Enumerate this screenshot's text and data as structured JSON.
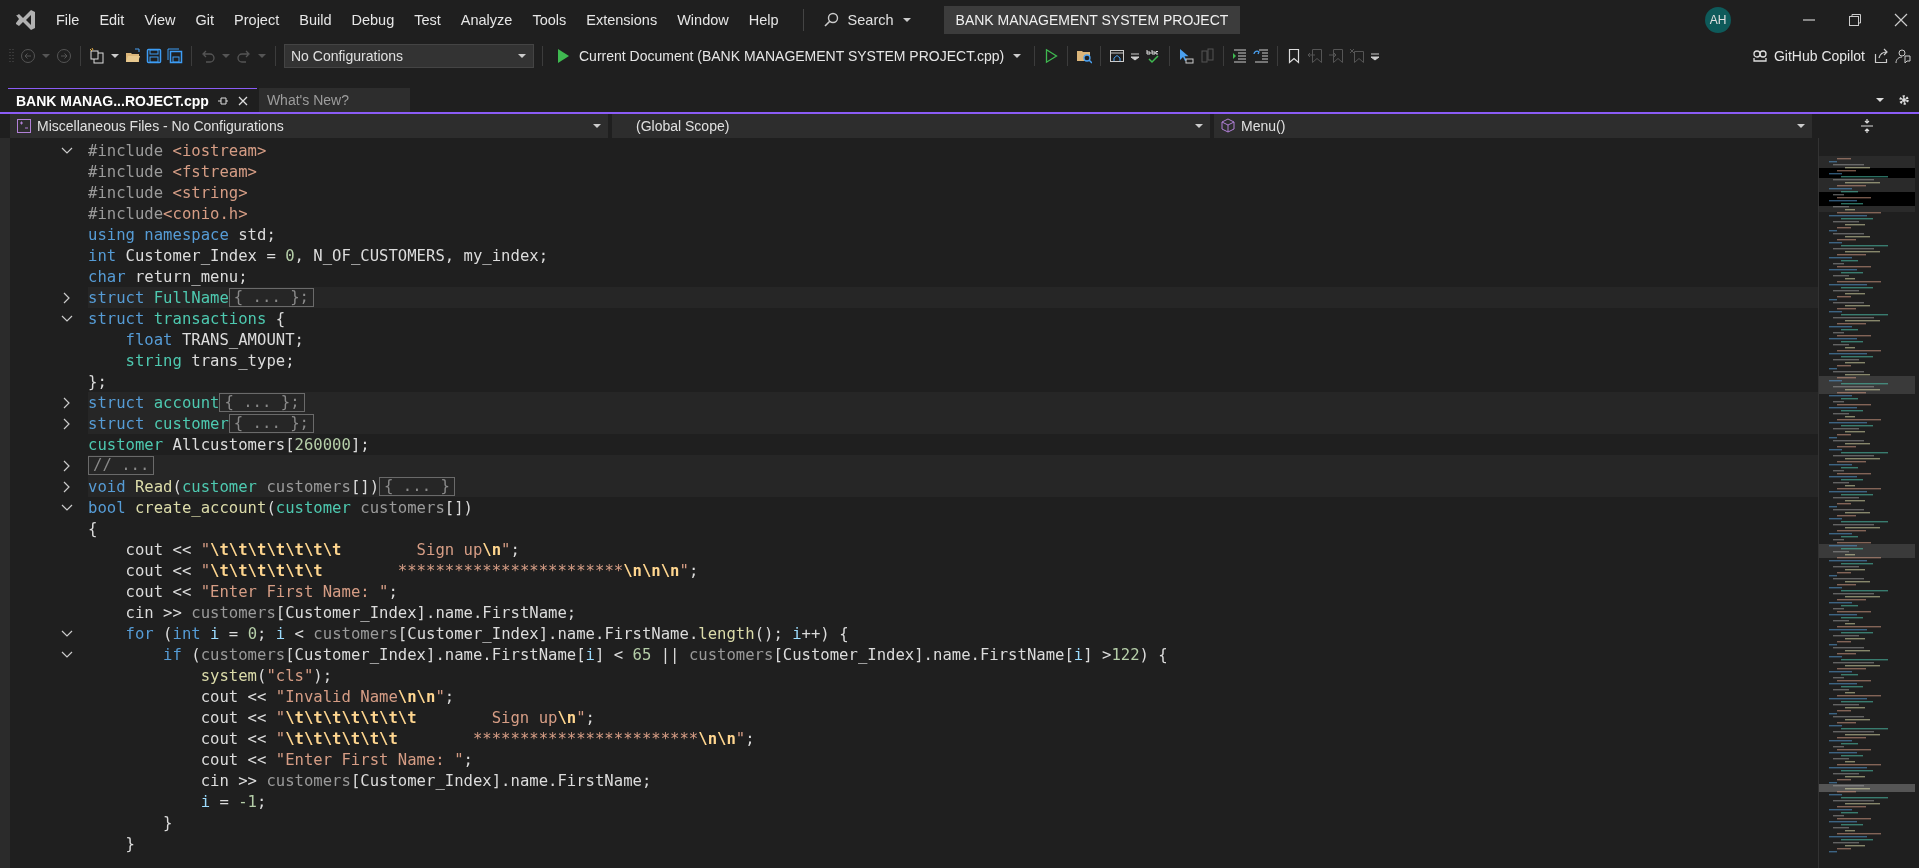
{
  "menu": [
    "File",
    "Edit",
    "View",
    "Git",
    "Project",
    "Build",
    "Debug",
    "Test",
    "Analyze",
    "Tools",
    "Extensions",
    "Window",
    "Help"
  ],
  "search": {
    "label": "Search"
  },
  "window": {
    "title": "BANK MANAGEMENT SYSTEM PROJECT",
    "avatar": "AH"
  },
  "toolbar": {
    "configuration": "No Configurations",
    "run_target": "Current Document (BANK MANAGEMENT SYSTEM PROJECT.cpp)",
    "copilot": "GitHub Copilot"
  },
  "tabs": [
    {
      "label": "BANK MANAG...ROJECT.cpp",
      "selected": true
    },
    {
      "label": "What's New?",
      "selected": false
    }
  ],
  "navigation": {
    "project": "Miscellaneous Files - No Configurations",
    "scope": "(Global Scope)",
    "member": "Menu()"
  },
  "code": [
    {
      "expanded": true,
      "tokens": [
        {
          "kind": "preprocessor",
          "text": "#include "
        },
        {
          "kind": "string",
          "text": "<iostream>"
        }
      ]
    },
    {
      "tokens": [
        {
          "kind": "preprocessor",
          "text": "#include "
        },
        {
          "kind": "string",
          "text": "<fstream>"
        }
      ]
    },
    {
      "tokens": [
        {
          "kind": "preprocessor",
          "text": "#include "
        },
        {
          "kind": "string",
          "text": "<string>"
        }
      ]
    },
    {
      "tokens": [
        {
          "kind": "preprocessor",
          "text": "#include"
        },
        {
          "kind": "string",
          "text": "<conio.h>"
        }
      ]
    },
    {
      "tokens": [
        {
          "kind": "keyword",
          "text": "using namespace"
        },
        {
          "kind": "plain",
          "text": " std;"
        }
      ]
    },
    {
      "tokens": [
        {
          "kind": "keyword",
          "text": "int"
        },
        {
          "kind": "plain",
          "text": " Customer_Index = "
        },
        {
          "kind": "number",
          "text": "0"
        },
        {
          "kind": "plain",
          "text": ", N_OF_CUSTOMERS, my_index;"
        }
      ]
    },
    {
      "tokens": [
        {
          "kind": "keyword",
          "text": "char"
        },
        {
          "kind": "plain",
          "text": " return_menu;"
        }
      ]
    },
    {
      "expanded": false,
      "collapsed": "{ ... };",
      "tokens": [
        {
          "kind": "keyword",
          "text": "struct"
        },
        {
          "kind": "type",
          "text": " FullName"
        }
      ]
    },
    {
      "expanded": true,
      "tokens": [
        {
          "kind": "keyword",
          "text": "struct"
        },
        {
          "kind": "type",
          "text": " transactions"
        },
        {
          "kind": "plain",
          "text": " {"
        }
      ]
    },
    {
      "tokens": [
        {
          "kind": "keyword",
          "text": "    float"
        },
        {
          "kind": "plain",
          "text": " TRANS_AMOUNT;"
        }
      ]
    },
    {
      "tokens": [
        {
          "kind": "type",
          "text": "    string"
        },
        {
          "kind": "plain",
          "text": " trans_type;"
        }
      ]
    },
    {
      "tokens": [
        {
          "kind": "plain",
          "text": "};"
        }
      ]
    },
    {
      "expanded": false,
      "collapsed": "{ ... };",
      "tokens": [
        {
          "kind": "keyword",
          "text": "struct"
        },
        {
          "kind": "type",
          "text": " account"
        }
      ]
    },
    {
      "expanded": false,
      "collapsed": "{ ... };",
      "tokens": [
        {
          "kind": "keyword",
          "text": "struct"
        },
        {
          "kind": "type",
          "text": " customer"
        }
      ]
    },
    {
      "tokens": [
        {
          "kind": "type",
          "text": "customer"
        },
        {
          "kind": "plain",
          "text": " Allcustomers["
        },
        {
          "kind": "number",
          "text": "260000"
        },
        {
          "kind": "plain",
          "text": "];"
        }
      ]
    },
    {
      "expanded": false,
      "collapsed": "// ..."
    },
    {
      "expanded": false,
      "collapsed": "{ ... }",
      "tokens": [
        {
          "kind": "keyword",
          "text": "void"
        },
        {
          "kind": "function",
          "text": " Read"
        },
        {
          "kind": "plain",
          "text": "("
        },
        {
          "kind": "type",
          "text": "customer"
        },
        {
          "kind": "parameter",
          "text": " customers"
        },
        {
          "kind": "plain",
          "text": "[])"
        }
      ]
    },
    {
      "expanded": true,
      "tokens": [
        {
          "kind": "keyword",
          "text": "bool"
        },
        {
          "kind": "function",
          "text": " create_account"
        },
        {
          "kind": "plain",
          "text": "("
        },
        {
          "kind": "type",
          "text": "customer"
        },
        {
          "kind": "parameter",
          "text": " customers"
        },
        {
          "kind": "plain",
          "text": "[])"
        }
      ]
    },
    {
      "tokens": [
        {
          "kind": "plain",
          "text": "{"
        }
      ]
    },
    {
      "tokens": [
        {
          "kind": "plain",
          "text": "    cout << "
        },
        {
          "kind": "string",
          "text": "\""
        },
        {
          "kind": "escape",
          "text": "\\t\\t\\t\\t\\t\\t\\t"
        },
        {
          "kind": "string",
          "text": "        Sign up"
        },
        {
          "kind": "escape",
          "text": "\\n"
        },
        {
          "kind": "string",
          "text": "\""
        },
        {
          "kind": "plain",
          "text": ";"
        }
      ]
    },
    {
      "tokens": [
        {
          "kind": "plain",
          "text": "    cout << "
        },
        {
          "kind": "string",
          "text": "\""
        },
        {
          "kind": "escape",
          "text": "\\t\\t\\t\\t\\t\\t"
        },
        {
          "kind": "string",
          "text": "        ************************"
        },
        {
          "kind": "escape",
          "text": "\\n\\n\\n"
        },
        {
          "kind": "string",
          "text": "\""
        },
        {
          "kind": "plain",
          "text": ";"
        }
      ]
    },
    {
      "tokens": [
        {
          "kind": "plain",
          "text": "    cout << "
        },
        {
          "kind": "string",
          "text": "\"Enter First Name: \""
        },
        {
          "kind": "plain",
          "text": ";"
        }
      ]
    },
    {
      "tokens": [
        {
          "kind": "plain",
          "text": "    cin >> "
        },
        {
          "kind": "parameter",
          "text": "customers"
        },
        {
          "kind": "plain",
          "text": "[Customer_Index].name.FirstName;"
        }
      ]
    },
    {
      "expanded": true,
      "tokens": [
        {
          "kind": "keyword",
          "text": "    for"
        },
        {
          "kind": "plain",
          "text": " ("
        },
        {
          "kind": "keyword",
          "text": "int"
        },
        {
          "kind": "variable",
          "text": " i"
        },
        {
          "kind": "plain",
          "text": " = "
        },
        {
          "kind": "number",
          "text": "0"
        },
        {
          "kind": "plain",
          "text": "; "
        },
        {
          "kind": "variable",
          "text": "i"
        },
        {
          "kind": "plain",
          "text": " < "
        },
        {
          "kind": "parameter",
          "text": "customers"
        },
        {
          "kind": "plain",
          "text": "[Customer_Index].name.FirstName."
        },
        {
          "kind": "function",
          "text": "length"
        },
        {
          "kind": "plain",
          "text": "(); "
        },
        {
          "kind": "variable",
          "text": "i"
        },
        {
          "kind": "plain",
          "text": "++) {"
        }
      ]
    },
    {
      "expanded": true,
      "tokens": [
        {
          "kind": "keyword",
          "text": "        if"
        },
        {
          "kind": "plain",
          "text": " ("
        },
        {
          "kind": "parameter",
          "text": "customers"
        },
        {
          "kind": "plain",
          "text": "[Customer_Index].name.FirstName["
        },
        {
          "kind": "variable",
          "text": "i"
        },
        {
          "kind": "plain",
          "text": "] < "
        },
        {
          "kind": "number",
          "text": "65"
        },
        {
          "kind": "plain",
          "text": " || "
        },
        {
          "kind": "parameter",
          "text": "customers"
        },
        {
          "kind": "plain",
          "text": "[Customer_Index].name.FirstName["
        },
        {
          "kind": "variable",
          "text": "i"
        },
        {
          "kind": "plain",
          "text": "] >"
        },
        {
          "kind": "number",
          "text": "122"
        },
        {
          "kind": "plain",
          "text": ") {"
        }
      ]
    },
    {
      "tokens": [
        {
          "kind": "function",
          "text": "            system"
        },
        {
          "kind": "plain",
          "text": "("
        },
        {
          "kind": "string",
          "text": "\"cls\""
        },
        {
          "kind": "plain",
          "text": ");"
        }
      ]
    },
    {
      "tokens": [
        {
          "kind": "plain",
          "text": "            cout << "
        },
        {
          "kind": "string",
          "text": "\"Invalid Name"
        },
        {
          "kind": "escape",
          "text": "\\n\\n"
        },
        {
          "kind": "string",
          "text": "\""
        },
        {
          "kind": "plain",
          "text": ";"
        }
      ]
    },
    {
      "tokens": [
        {
          "kind": "plain",
          "text": "            cout << "
        },
        {
          "kind": "string",
          "text": "\""
        },
        {
          "kind": "escape",
          "text": "\\t\\t\\t\\t\\t\\t\\t"
        },
        {
          "kind": "string",
          "text": "        Sign up"
        },
        {
          "kind": "escape",
          "text": "\\n"
        },
        {
          "kind": "string",
          "text": "\""
        },
        {
          "kind": "plain",
          "text": ";"
        }
      ]
    },
    {
      "tokens": [
        {
          "kind": "plain",
          "text": "            cout << "
        },
        {
          "kind": "string",
          "text": "\""
        },
        {
          "kind": "escape",
          "text": "\\t\\t\\t\\t\\t\\t"
        },
        {
          "kind": "string",
          "text": "        ************************"
        },
        {
          "kind": "escape",
          "text": "\\n\\n"
        },
        {
          "kind": "string",
          "text": "\""
        },
        {
          "kind": "plain",
          "text": ";"
        }
      ]
    },
    {
      "tokens": [
        {
          "kind": "plain",
          "text": "            cout << "
        },
        {
          "kind": "string",
          "text": "\"Enter First Name: \""
        },
        {
          "kind": "plain",
          "text": ";"
        }
      ]
    },
    {
      "tokens": [
        {
          "kind": "plain",
          "text": "            cin >> "
        },
        {
          "kind": "parameter",
          "text": "customers"
        },
        {
          "kind": "plain",
          "text": "[Customer_Index].name.FirstName;"
        }
      ]
    },
    {
      "tokens": [
        {
          "kind": "variable",
          "text": "            i"
        },
        {
          "kind": "plain",
          "text": " = "
        },
        {
          "kind": "number",
          "text": "-1"
        },
        {
          "kind": "plain",
          "text": ";"
        }
      ]
    },
    {
      "tokens": [
        {
          "kind": "plain",
          "text": "        }"
        }
      ]
    },
    {
      "tokens": [
        {
          "kind": "plain",
          "text": "    }"
        }
      ]
    }
  ]
}
